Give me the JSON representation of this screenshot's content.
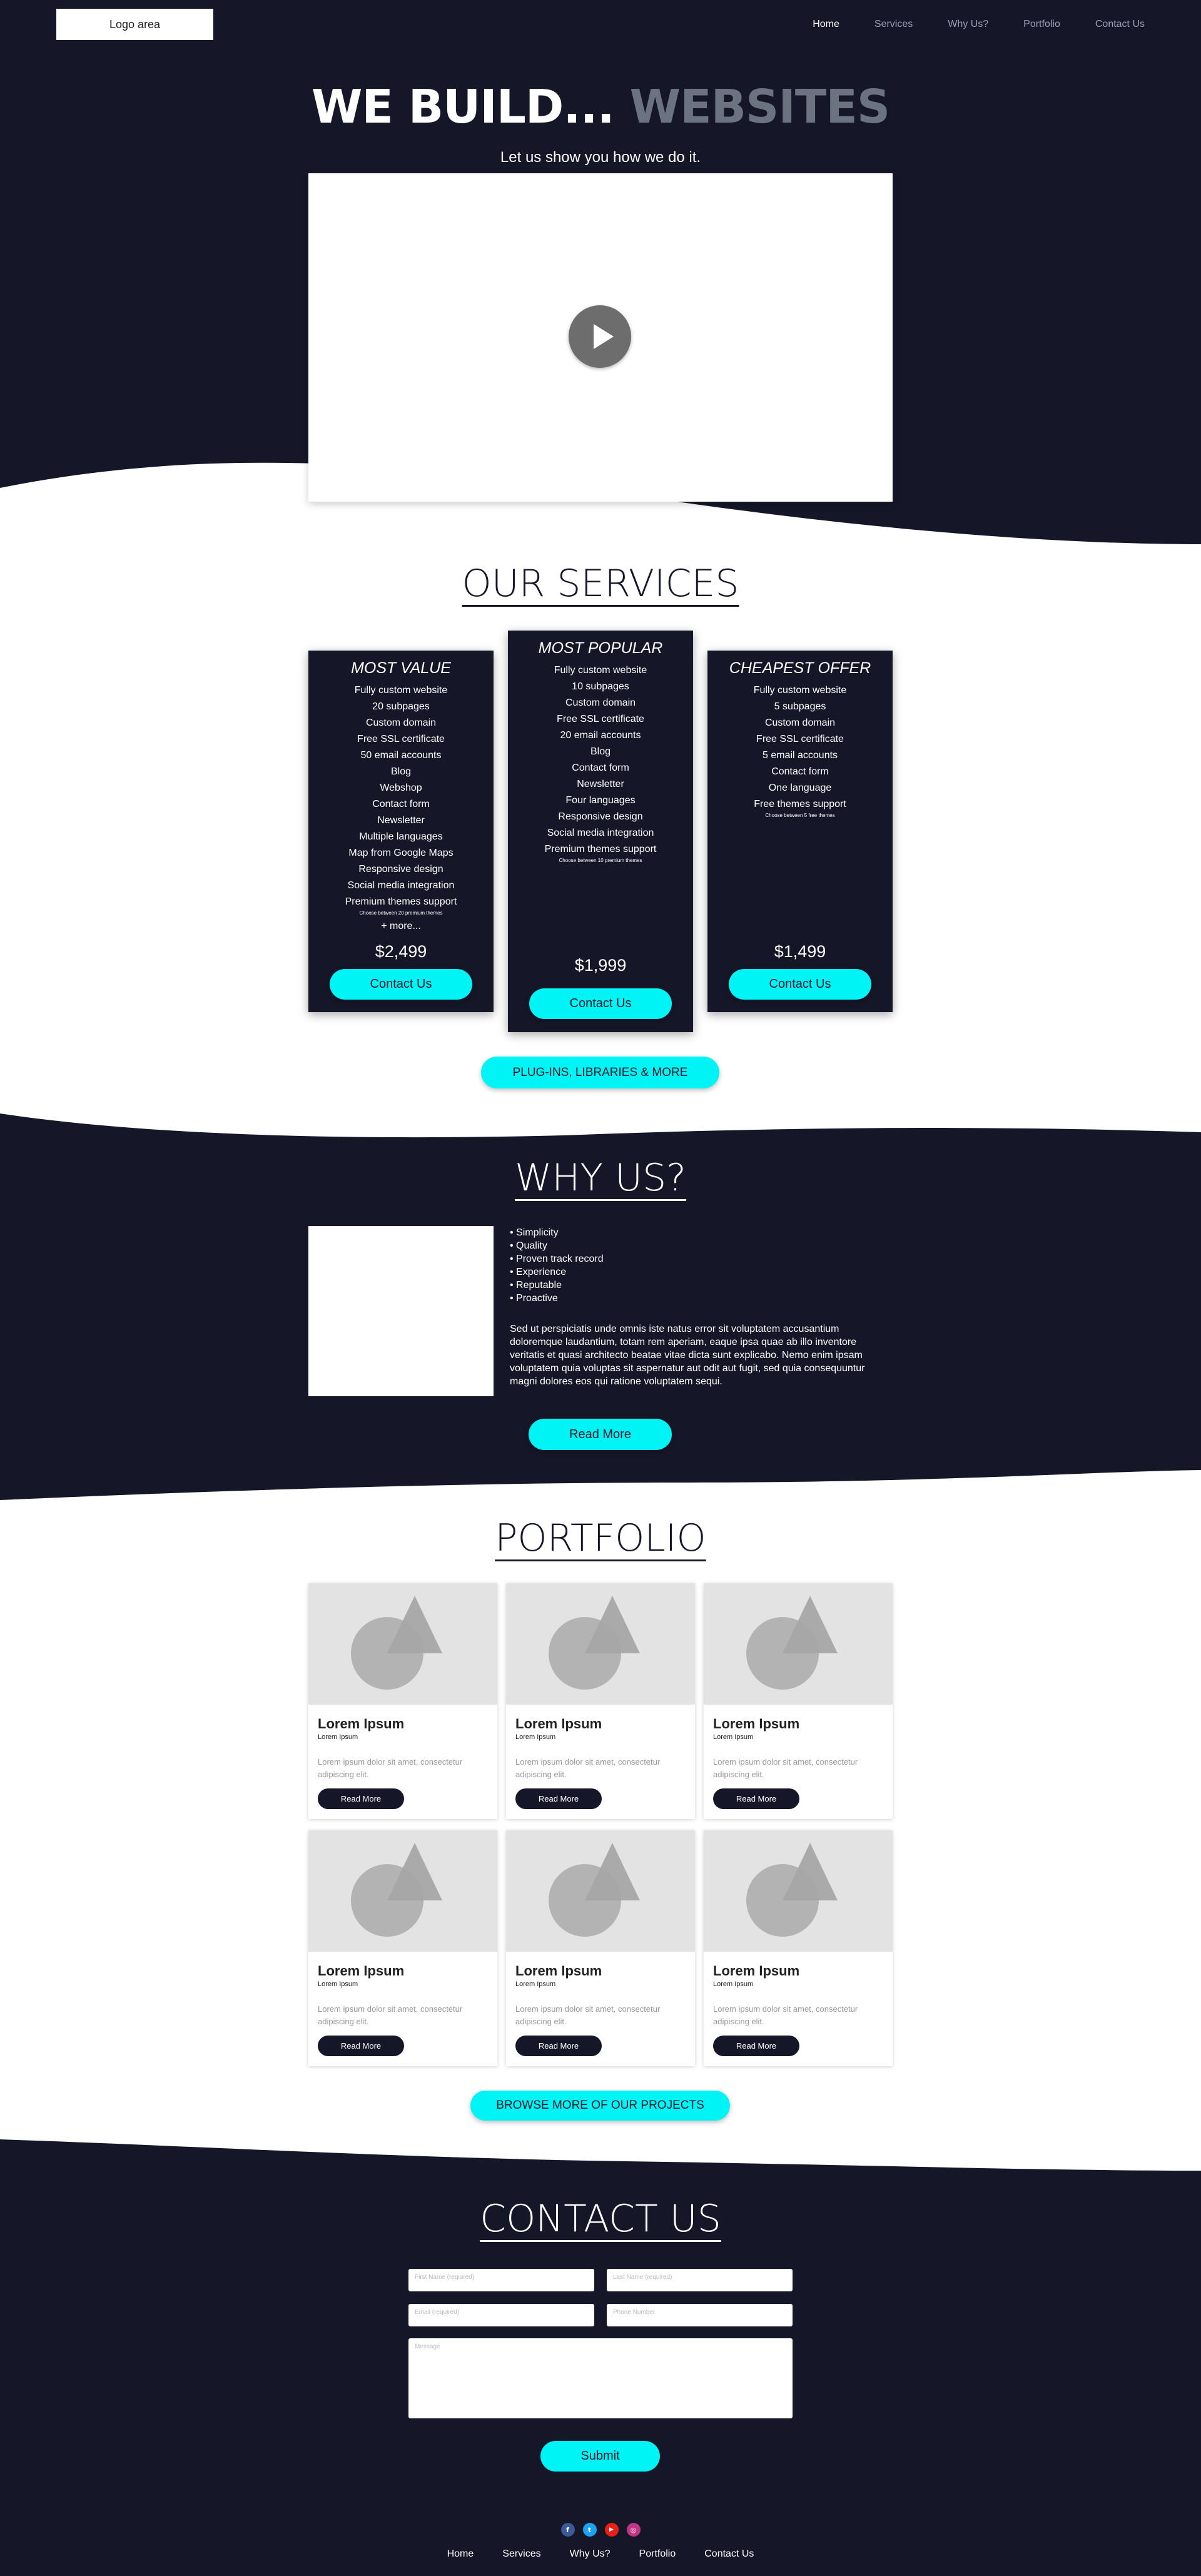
{
  "header": {
    "logo": "Logo area",
    "nav": [
      "Home",
      "Services",
      "Why Us?",
      "Portfolio",
      "Contact Us"
    ]
  },
  "hero": {
    "title_main": "WE BUILD...",
    "title_accent": "WEBSITES",
    "subtitle": "Let us show you how we do it."
  },
  "services": {
    "title": "OUR SERVICES",
    "cards": [
      {
        "title": "MOST VALUE",
        "features": [
          "Fully custom website",
          "20 subpages",
          "Custom domain",
          "Free SSL certificate",
          "50 email accounts",
          "Blog",
          "Webshop",
          "Contact form",
          "Newsletter",
          "Multiple languages",
          "Map from Google Maps",
          "Responsive design",
          "Social media integration",
          "Premium themes support"
        ],
        "note": "Choose between 20 premium themes",
        "more": "+ more...",
        "price": "$2,499",
        "button": "Contact Us"
      },
      {
        "title": "MOST POPULAR",
        "features": [
          "Fully custom website",
          "10 subpages",
          "Custom domain",
          "Free SSL certificate",
          "20 email accounts",
          "Blog",
          "Contact form",
          "Newsletter",
          "Four languages",
          "Responsive design",
          "Social media integration",
          "Premium themes support"
        ],
        "note": "Choose between 10 premium themes",
        "price": "$1,999",
        "button": "Contact Us"
      },
      {
        "title": "CHEAPEST OFFER",
        "features": [
          "Fully custom website",
          "5 subpages",
          "Custom domain",
          "Free SSL certificate",
          "5 email accounts",
          "Contact form",
          "One language",
          "Free themes support"
        ],
        "note": "Choose between 5 free themes",
        "price": "$1,499",
        "button": "Contact Us"
      }
    ],
    "plugins_button": "PLUG-INS, LIBRARIES & MORE"
  },
  "why": {
    "title": "WHY US?",
    "bullets": [
      "• Simplicity",
      "• Quality",
      "• Proven track record",
      "• Experience",
      "• Reputable",
      "• Proactive"
    ],
    "text": "Sed ut perspiciatis unde omnis iste natus error sit voluptatem accusantium doloremque laudantium, totam rem aperiam, eaque ipsa quae ab illo inventore veritatis et quasi architecto beatae vitae dicta sunt explicabo. Nemo enim ipsam voluptatem quia voluptas sit aspernatur aut odit aut fugit, sed quia consequuntur magni dolores eos qui ratione voluptatem sequi.",
    "button": "Read More"
  },
  "portfolio": {
    "title": "PORTFOLIO",
    "items": [
      {
        "title": "Lorem Ipsum",
        "subtitle": "Lorem Ipsum",
        "text": "Lorem ipsum dolor sit amet, consectetur adipiscing elit.",
        "button": "Read More"
      },
      {
        "title": "Lorem Ipsum",
        "subtitle": "Lorem Ipsum",
        "text": "Lorem ipsum dolor sit amet, consectetur adipiscing elit.",
        "button": "Read More"
      },
      {
        "title": "Lorem Ipsum",
        "subtitle": "Lorem Ipsum",
        "text": "Lorem ipsum dolor sit amet, consectetur adipiscing elit.",
        "button": "Read More"
      },
      {
        "title": "Lorem Ipsum",
        "subtitle": "Lorem Ipsum",
        "text": "Lorem ipsum dolor sit amet, consectetur adipiscing elit.",
        "button": "Read More"
      },
      {
        "title": "Lorem Ipsum",
        "subtitle": "Lorem Ipsum",
        "text": "Lorem ipsum dolor sit amet, consectetur adipiscing elit.",
        "button": "Read More"
      },
      {
        "title": "Lorem Ipsum",
        "subtitle": "Lorem Ipsum",
        "text": "Lorem ipsum dolor sit amet, consectetur adipiscing elit.",
        "button": "Read More"
      }
    ],
    "browse_button": "BROWSE MORE OF OUR PROJECTS"
  },
  "contact": {
    "title": "CONTACT US",
    "first_name_placeholder": "First Name (required)",
    "last_name_placeholder": "Last Name (required)",
    "email_placeholder": "Email (required)",
    "phone_placeholder": "Phone Number",
    "message_placeholder": "Message",
    "submit": "Submit"
  },
  "footer": {
    "social": [
      {
        "icon": "facebook-icon",
        "glyph": "f",
        "color": "#3b5998"
      },
      {
        "icon": "twitter-icon",
        "glyph": "t",
        "color": "#1da1f2"
      },
      {
        "icon": "youtube-icon",
        "glyph": "▶",
        "color": "#e62117"
      },
      {
        "icon": "instagram-icon",
        "glyph": "◎",
        "color": "#c13584"
      }
    ],
    "nav": [
      "Home",
      "Services",
      "Why Us?",
      "Portfolio",
      "Contact Us"
    ]
  },
  "colors": {
    "navy": "#151729",
    "accent": "#00f4f6",
    "grey_text": "#6b7280"
  }
}
